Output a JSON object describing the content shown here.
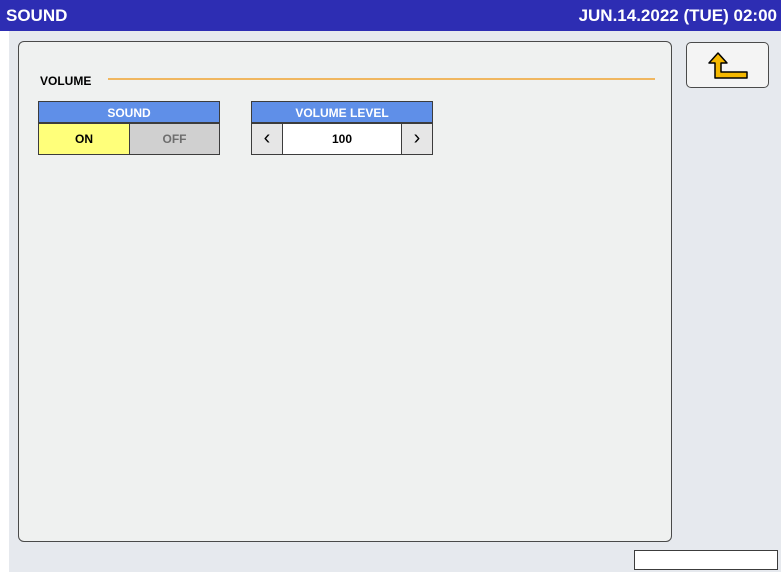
{
  "window": {
    "title": "SOUND",
    "datetime": "JUN.14.2022 (TUE)  02:00"
  },
  "volume_section": {
    "label": "VOLUME",
    "sound": {
      "header": "SOUND",
      "on_label": "ON",
      "off_label": "OFF",
      "selected": "ON"
    },
    "volume_level": {
      "header": "VOLUME LEVEL",
      "value": "100",
      "decrease_icon": "chevron-left-icon",
      "increase_icon": "chevron-right-icon"
    }
  },
  "sidebar": {
    "back_icon": "return-arrow-icon"
  },
  "status_box": {
    "text": ""
  },
  "colors": {
    "titlebar": "#2d2db3",
    "header": "#5f8fe8",
    "selected": "#ffff7a",
    "unselected": "#d0d0d0",
    "divider": "#f0b760",
    "back_arrow": "#f5b800"
  }
}
